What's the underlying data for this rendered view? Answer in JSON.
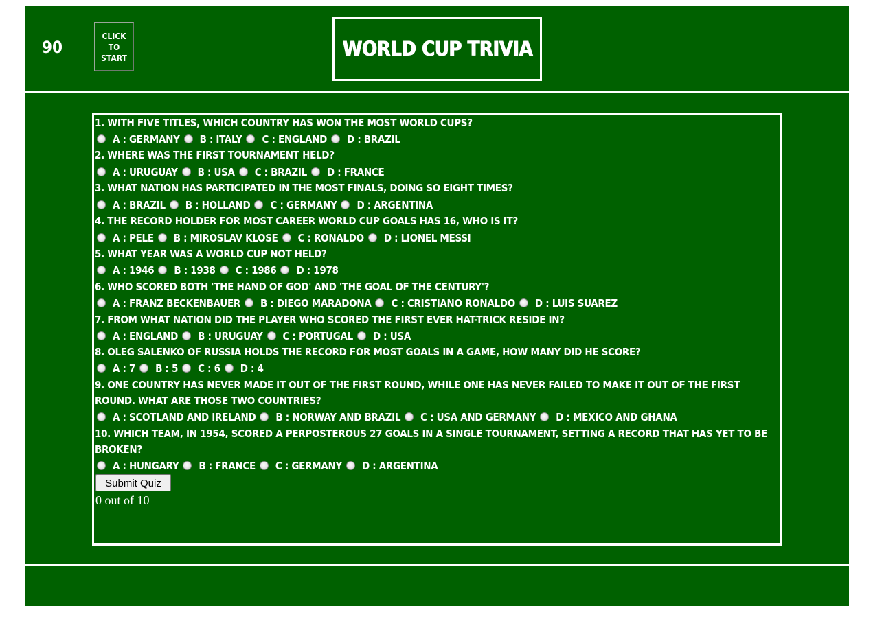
{
  "header": {
    "timer": "90",
    "start_button_label": "CLICK TO START",
    "title": "WORLD CUP TRIVIA"
  },
  "questions": [
    {
      "text": "1. With five titles, which country has won the most world cups?",
      "options": [
        "A : GERMANY",
        "B : ITALY",
        "C : ENGLAND",
        "D : BRAZIL"
      ]
    },
    {
      "text": "2. Where was the first tournament held?",
      "options": [
        "A : URUGUAY",
        "B : USA",
        "C : BRAZIL",
        "D : FRANCE"
      ]
    },
    {
      "text": "3. What nation has participated in the most finals, doing so eight times?",
      "options": [
        "A : BRAZIL",
        "B : HOLLAND",
        "C : GERMANY",
        "D : ARGENTINA"
      ]
    },
    {
      "text": "4. The record holder for most career world cup goals has 16, who is it?",
      "options": [
        "A : PELE",
        "B : MIROSLAV KLOSE",
        "C : RONALDO",
        "D : LIONEL MESSI"
      ]
    },
    {
      "text": "5. What year was a world cup not held?",
      "options": [
        "A : 1946",
        "B : 1938",
        "C : 1986",
        "D : 1978"
      ]
    },
    {
      "text": "6. Who scored both 'the hand of god' and 'the goal of the century'?",
      "options": [
        "A : FRANZ BECKENBAUER",
        "B : DIEGO MARADONA",
        "C : CRISTIANO RONALDO",
        "D : LUIS SUAREZ"
      ]
    },
    {
      "text": "7. From what nation did the player who scored the first ever hat-trick reside in?",
      "options": [
        "A : ENGLAND",
        "B : URUGUAY",
        "C : PORTUGAL",
        "D : USA"
      ]
    },
    {
      "text": "8. Oleg Salenko of Russia holds the record for most goals in a game, how many did he score?",
      "options": [
        "A : 7",
        "B : 5",
        "C : 6",
        "D : 4"
      ]
    },
    {
      "text": "9. One country has never made it out of the first round, while one has never failed to make it out of the first round. What are those two countries?",
      "options": [
        "A : SCOTLAND AND IRELAND",
        "B : NORWAY AND BRAZIL",
        "C : USA AND GERMANY",
        "D : MEXICO AND GHANA"
      ]
    },
    {
      "text": "10. Which team, in 1954, scored a perposterous 27 goals in a single tournament, setting a record that has yet to be broken?",
      "options": [
        "A : HUNGARY",
        "B : FRANCE",
        "C : GERMANY",
        "D : ARGENTINA"
      ]
    }
  ],
  "submit_label": "Submit Quiz",
  "score_text": "0 out of 10"
}
